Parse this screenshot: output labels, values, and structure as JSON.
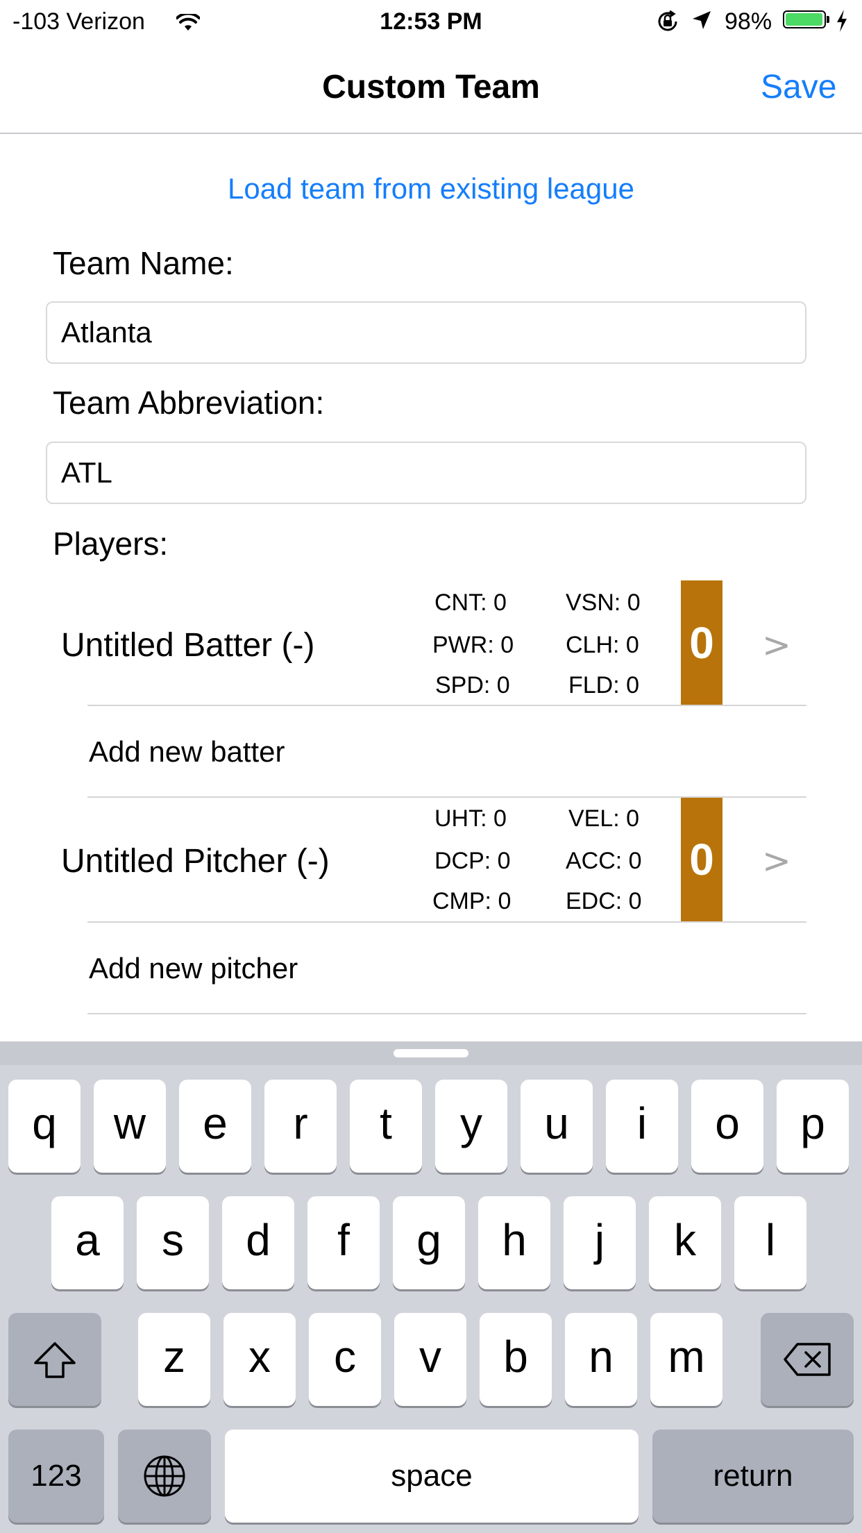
{
  "status_bar": {
    "carrier": "-103 Verizon",
    "time": "12:53 PM",
    "battery_percent": "98%",
    "battery_level": 0.98,
    "battery_color": "#4cd964",
    "icons": [
      "wifi-icon",
      "rotation-lock-icon",
      "location-arrow-icon",
      "battery-icon",
      "charging-bolt-icon"
    ]
  },
  "nav": {
    "title": "Custom Team",
    "save_label": "Save",
    "accent_color": "#157efb"
  },
  "load_link": "Load team from existing league",
  "form": {
    "team_name_label": "Team Name:",
    "team_name_value": "Atlanta",
    "team_abbr_label": "Team Abbreviation:",
    "team_abbr_value": "ATL",
    "players_label": "Players:"
  },
  "batter": {
    "name": "Untitled Batter (-)",
    "stats": [
      "CNT: 0",
      "VSN: 0",
      "PWR: 0",
      "CLH: 0",
      "SPD: 0",
      "FLD: 0"
    ],
    "rating": "0",
    "chevron": ">"
  },
  "add_batter": "Add new batter",
  "pitcher": {
    "name": "Untitled Pitcher (-)",
    "stats": [
      "UHT: 0",
      "VEL: 0",
      "DCP: 0",
      "ACC: 0",
      "CMP: 0",
      "EDC: 0"
    ],
    "rating": "0",
    "chevron": ">"
  },
  "add_pitcher": "Add new pitcher",
  "rating_color": "#b8740a",
  "keyboard": {
    "row1": [
      "q",
      "w",
      "e",
      "r",
      "t",
      "y",
      "u",
      "i",
      "o",
      "p"
    ],
    "row2": [
      "a",
      "s",
      "d",
      "f",
      "g",
      "h",
      "j",
      "k",
      "l"
    ],
    "row3": [
      "z",
      "x",
      "c",
      "v",
      "b",
      "n",
      "m"
    ],
    "numbers_label": "123",
    "space_label": "space",
    "return_label": "return",
    "special_icons": [
      "shift-icon",
      "delete-icon",
      "globe-icon"
    ]
  }
}
